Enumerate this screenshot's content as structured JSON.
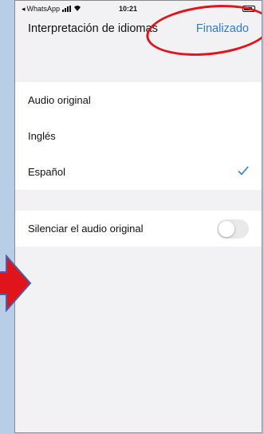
{
  "status_bar": {
    "back_app": "WhatsApp",
    "time": "10:21"
  },
  "header": {
    "title": "Interpretación de idiomas",
    "done_label": "Finalizado"
  },
  "audio_options": [
    {
      "label": "Audio original",
      "selected": false
    },
    {
      "label": "Inglés",
      "selected": false
    },
    {
      "label": "Español",
      "selected": true
    }
  ],
  "mute": {
    "label": "Silenciar el audio original",
    "enabled": false
  },
  "colors": {
    "accent": "#2f7bd6",
    "annotation": "#e0141b",
    "background": "#b8cde6"
  },
  "icons": {
    "selected": "checkmark-icon",
    "annotation_arrow": "arrow-right-icon",
    "annotation_circle": "circle-highlight"
  }
}
